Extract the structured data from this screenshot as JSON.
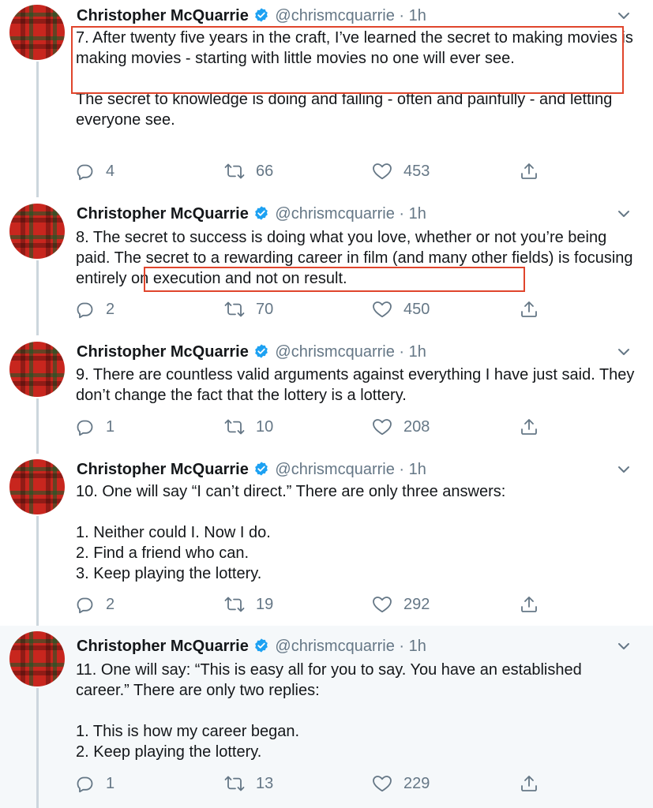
{
  "author": {
    "name": "Christopher McQuarrie",
    "handle": "@chrismcquarrie",
    "separator": "·"
  },
  "colors": {
    "highlight_box": "#e0452c",
    "verified": "#1da1f2",
    "muted_text": "#657786",
    "focused_bg": "#f5f8fa"
  },
  "icons": [
    "verified-badge-icon",
    "chevron-down-icon",
    "reply-icon",
    "retweet-icon",
    "like-icon",
    "share-icon"
  ],
  "tweets": [
    {
      "time": "1h",
      "text": "7. After twenty five years in the craft, I’ve learned the secret to making movies is making movies - starting with little movies no one will ever see.\n\nThe secret to knowledge is doing and failing - often and painfully - and letting everyone see.",
      "replies": "4",
      "retweets": "66",
      "likes": "453"
    },
    {
      "time": "1h",
      "text": "8. The secret to success is doing what you love, whether or not you’re being paid. The secret to a rewarding career in film (and many other fields) is focusing entirely on execution and not on result.",
      "replies": "2",
      "retweets": "70",
      "likes": "450"
    },
    {
      "time": "1h",
      "text": "9. There are countless valid arguments against everything I have just said. They don’t change the fact that the lottery is a lottery.",
      "replies": "1",
      "retweets": "10",
      "likes": "208"
    },
    {
      "time": "1h",
      "text": "10. One will say “I can’t direct.” There are only three answers:\n\n1. Neither could I. Now I do.\n2. Find a friend who can.\n3. Keep playing the lottery.",
      "replies": "2",
      "retweets": "19",
      "likes": "292"
    },
    {
      "time": "1h",
      "text": "11. One will say: “This is easy all for you to say. You have an established career.” There are only two replies:\n\n1. This is how my career began.\n2. Keep playing the lottery.",
      "replies": "1",
      "retweets": "13",
      "likes": "229"
    }
  ]
}
